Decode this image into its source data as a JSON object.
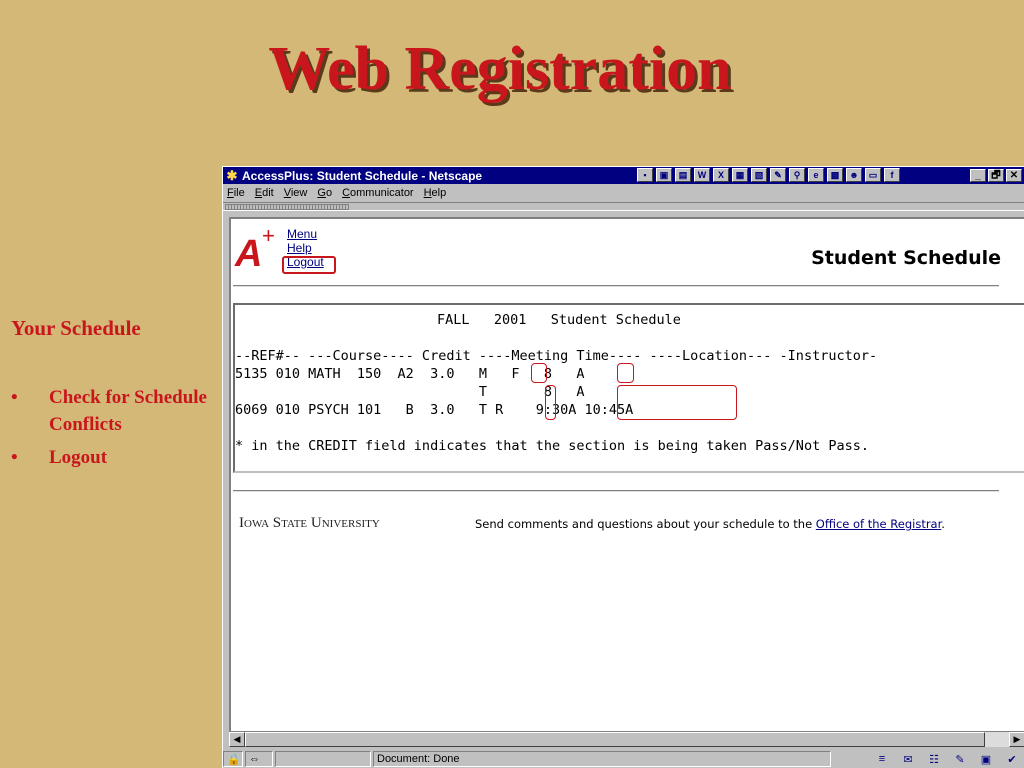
{
  "slide": {
    "title": "Web Registration",
    "side_heading": "Your Schedule",
    "bullets": [
      {
        "bullet": "•",
        "text": "Check for Schedule Conflicts"
      },
      {
        "bullet": "•",
        "text": "Logout"
      }
    ]
  },
  "window": {
    "title": "AccessPlus: Student Schedule - Netscape",
    "menu": [
      "File",
      "Edit",
      "View",
      "Go",
      "Communicator",
      "Help"
    ],
    "controls": {
      "minimize": "_",
      "maximize": "🗗",
      "close": "✕"
    }
  },
  "page": {
    "nav": {
      "menu": "Menu",
      "help": "Help",
      "logout": "Logout"
    },
    "heading": "Student Schedule",
    "schedule": {
      "title_line": "FALL   2001   Student Schedule",
      "header_line": "--REF#-- ---Course---- Credit ----Meeting Time---- ----Location--- -Instructor-",
      "rows": [
        "5135 010 MATH  150  A2  3.0   M   F   8   A",
        "                              T       8   A",
        "6069 010 PSYCH 101   B  3.0   T R    9:30A 10:45A"
      ],
      "note": "* in the CREDIT field indicates that the section is being taken Pass/Not Pass."
    },
    "footer": {
      "university": "Iowa State University",
      "comment_text": "Send comments and questions about your schedule to the ",
      "link_text": "Office of the Registrar",
      "comment_end": "."
    }
  },
  "status": {
    "text": "Document: Done"
  },
  "colors": {
    "accent": "#c8161c",
    "background": "#d3b877",
    "titlebar": "#000080"
  }
}
